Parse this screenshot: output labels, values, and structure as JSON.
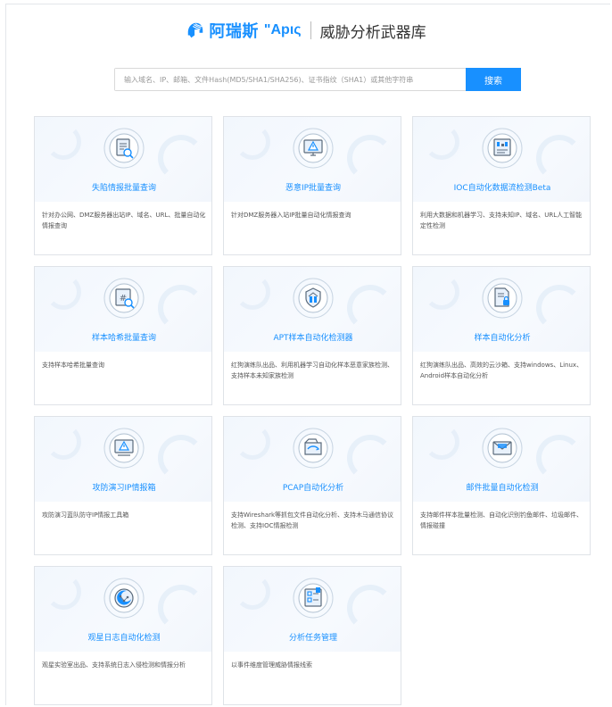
{
  "header": {
    "brand_cn": "阿瑞斯",
    "brand_en": "\"Aрις",
    "title": "威胁分析武器库"
  },
  "search": {
    "placeholder": "输入域名、IP、邮箱、文件Hash(MD5/SHA1/SHA256)、证书指纹（SHA1）或其他字符串",
    "button": "搜索"
  },
  "colors": {
    "accent": "#1890ff",
    "icon_stroke": "#5b6b7c",
    "icon_fill": "#e8f1fb"
  },
  "cards": [
    {
      "title": "失陷情报批量查询",
      "desc": "针对办公网、DMZ服务器出站IP、域名、URL、批量自动化情报查询",
      "icon": "document-search-icon"
    },
    {
      "title": "恶意IP批量查询",
      "desc": "针对DMZ服务器入站IP批量自动化情报查询",
      "icon": "monitor-warning-icon"
    },
    {
      "title": "IOC自动化数据流检测Beta",
      "desc": "利用大数据和机器学习、支持未知IP、域名、URL人工智能定性检测",
      "icon": "data-stream-icon"
    },
    {
      "title": "样本哈希批量查询",
      "desc": "支持样本哈希批量查询",
      "icon": "hash-search-icon"
    },
    {
      "title": "APT样本自动化检测器",
      "desc": "红狗演练队出品、利用机器学习自动化样本恶意家族检测、支持样本未知家族检测",
      "icon": "building-shield-icon"
    },
    {
      "title": "样本自动化分析",
      "desc": "红狗演练队出品、高效的云沙箱、支持windows、Linux、Android样本自动化分析",
      "icon": "file-lock-icon"
    },
    {
      "title": "攻防演习IP情报箱",
      "desc": "攻防演习蓝队防守IP情报工具箱",
      "icon": "alert-box-icon"
    },
    {
      "title": "PCAP自动化分析",
      "desc": "支持Wireshark等抓包文件自动化分析、支持木马通信协议检测、支持IOC情报检测",
      "icon": "packet-capture-icon"
    },
    {
      "title": "邮件批量自动化检测",
      "desc": "支持邮件样本批量检测、自动化识别钓鱼邮件、垃圾邮件、情报碰撞",
      "icon": "mail-check-icon"
    },
    {
      "title": "观星日志自动化检测",
      "desc": "观星实验室出品、支持系统日志入侵检测和情报分析",
      "icon": "star-log-icon"
    },
    {
      "title": "分析任务管理",
      "desc": "以事件维度管理威胁情报线索",
      "icon": "task-manage-icon"
    }
  ]
}
